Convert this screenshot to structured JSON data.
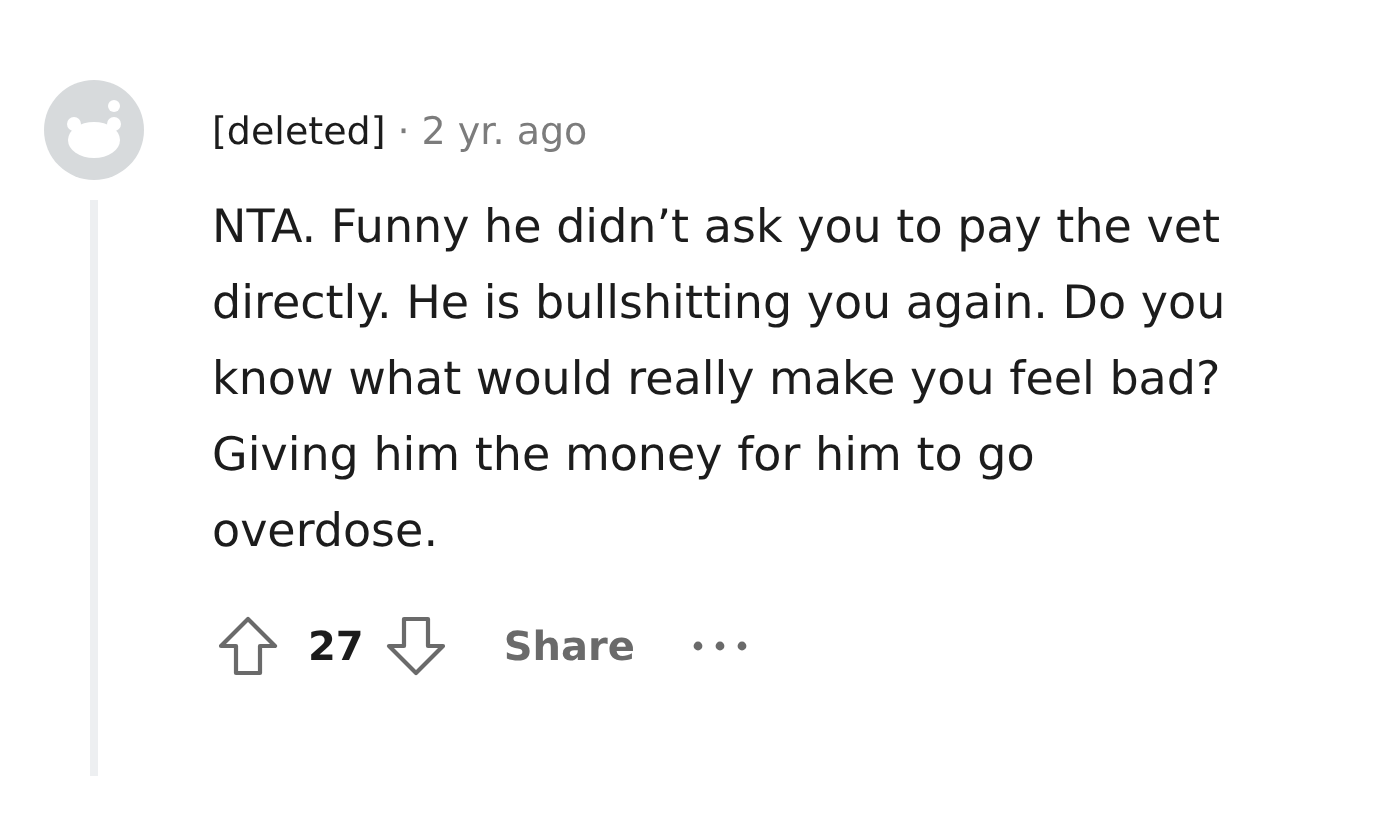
{
  "comment": {
    "author": "[deleted]",
    "separator": "·",
    "time": "2 yr. ago",
    "body": "NTA. Funny he didn’t ask you to pay the vet directly. He is bullshitting you again. Do you know what would really make you feel bad? Giving him the money for him to go overdose.",
    "votes": "27",
    "share": "Share"
  }
}
